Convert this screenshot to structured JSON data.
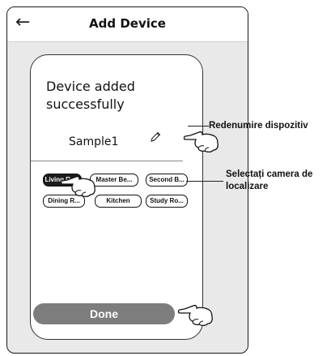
{
  "header": {
    "back_icon": "arrow-left-icon",
    "title": "Add Device"
  },
  "card": {
    "message_line1": "Device added",
    "message_line2": "successfully",
    "device_name": "Sample1",
    "edit_icon": "pencil-icon",
    "rooms": [
      "Living Ro...",
      "Master Be...",
      "Second B...",
      "Dining R...",
      "Kitchen",
      "Study Ro..."
    ],
    "selected_room": "Living Ro...",
    "done_label": "Done"
  },
  "callouts": {
    "rename": "Redenumire dispozitiv",
    "select_room_line1": "Selectați camera de",
    "select_room_line2": "localizare"
  },
  "colors": {
    "selected_room_bg": "#1c1c1c",
    "done_button": "#7d7d7d",
    "background": "#e9e9e9"
  }
}
